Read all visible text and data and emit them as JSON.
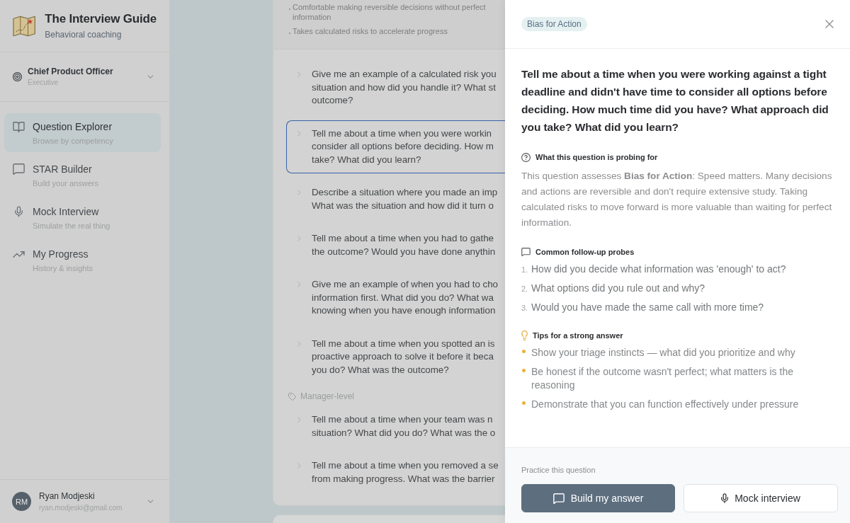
{
  "app": {
    "title": "The Interview Guide",
    "subtitle": "Behavioral coaching"
  },
  "role_selector": {
    "title": "Chief Product Officer",
    "subtitle": "Executive"
  },
  "sidebar": {
    "nav_items": [
      {
        "title": "Question Explorer",
        "subtitle": "Browse by competency",
        "selected": true
      },
      {
        "title": "STAR Builder",
        "subtitle": "Build your answers",
        "selected": false
      },
      {
        "title": "Mock Interview",
        "subtitle": "Simulate the real thing",
        "selected": false
      },
      {
        "title": "My Progress",
        "subtitle": "History & insights",
        "selected": false
      }
    ]
  },
  "user": {
    "initials": "RM",
    "name": "Ryan Modjeski",
    "email": "ryan.modjeski@gmail.com"
  },
  "competency_card": {
    "traits": [
      "Comfortable making reversible decisions without perfect information",
      "Takes calculated risks to accelerate progress"
    ],
    "groups": [
      {
        "questions": [
          {
            "lines": [
              "Give me an example of a calculated risk you",
              "situation and how did you handle it? What st",
              "outcome?"
            ],
            "selected": false
          },
          {
            "lines": [
              "Tell me about a time when you were workin",
              "consider all options before deciding. How m",
              "take? What did you learn?"
            ],
            "selected": true
          },
          {
            "lines": [
              "Describe a situation where you made an imp",
              "What was the situation and how did it turn o"
            ],
            "selected": false
          },
          {
            "lines": [
              "Tell me about a time when you had to gathe",
              "the outcome? Would you have done anythin"
            ],
            "selected": false
          },
          {
            "lines": [
              "Give me an example of when you had to cho",
              "information first. What did you do? What wa",
              "knowing when you have enough information"
            ],
            "selected": false
          },
          {
            "lines": [
              "Tell me about a time when you spotted an is",
              "proactive approach to solve it before it beca",
              "you do? What was the outcome?"
            ],
            "selected": false
          }
        ]
      },
      {
        "label": "Manager-level",
        "questions": [
          {
            "lines": [
              "Tell me about a time when your team was n",
              "situation? What did you do? What was the o"
            ],
            "selected": false
          },
          {
            "lines": [
              "Tell me about a time when you removed a se",
              "from making progress. What was the barrier"
            ],
            "selected": false
          }
        ]
      }
    ]
  },
  "drawer": {
    "tag": "Bias for Action",
    "question": "Tell me about a time when you were working against a tight deadline and didn't have time to consider all options before deciding. How much time did you have? What approach did you take? What did you learn?",
    "sections": [
      {
        "kind": "probing",
        "heading": "What this question is probing for",
        "text": "This question assesses **Bias for Action**: Speed matters. Many decisions and actions are reversible and don't require extensive study. Taking calculated risks to move forward is more valuable than waiting for perfect information."
      },
      {
        "kind": "probes",
        "heading": "Common follow-up probes",
        "items": [
          {
            "number": "1.",
            "text": "How did you decide what information was 'enough' to act?"
          },
          {
            "number": "2.",
            "text": "What options did you rule out and why?"
          },
          {
            "number": "3.",
            "text": "Would you have made the same call with more time?"
          }
        ]
      },
      {
        "kind": "tips",
        "heading": "Tips for a strong answer",
        "items": [
          {
            "text": "Show your triage instincts — what did you prioritize and why"
          },
          {
            "text": "Be honest if the outcome wasn't perfect; what matters is the reasoning"
          },
          {
            "text": "Demonstrate that you can function effectively under pressure"
          }
        ]
      }
    ],
    "footer": {
      "label": "Practice this question",
      "buttons": [
        {
          "kind": "primary",
          "label": "Build my answer"
        },
        {
          "kind": "secondary",
          "label": "Mock interview"
        }
      ]
    }
  }
}
